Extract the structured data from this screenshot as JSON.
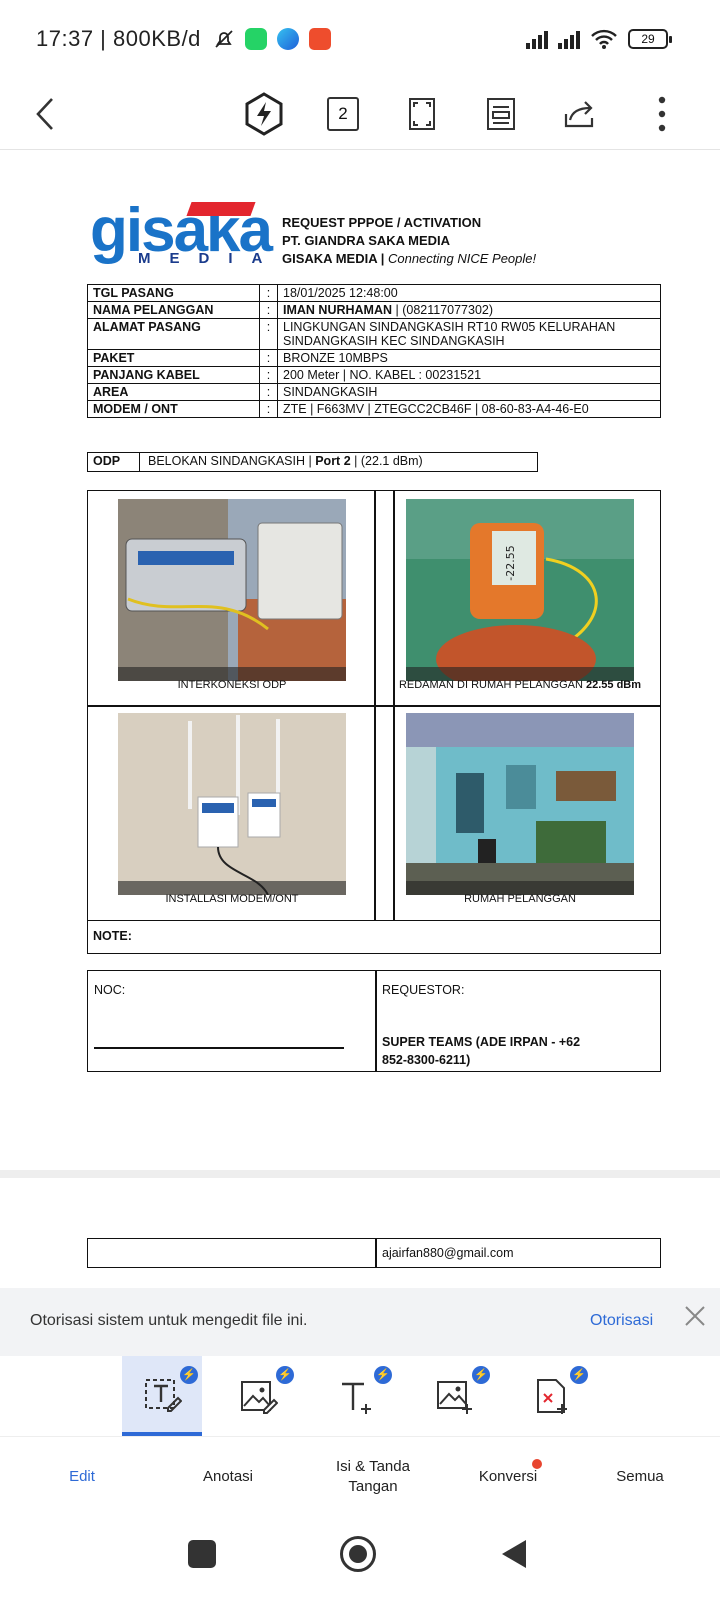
{
  "status": {
    "time": "17:37",
    "network": "800KB/d",
    "battery": "29"
  },
  "toolbar": {
    "page_count": "2",
    "icons": [
      "back-icon",
      "power-mode-icon",
      "page-count",
      "fullscreen-icon",
      "read-mode-icon",
      "share-icon",
      "more-icon"
    ]
  },
  "document": {
    "logo": {
      "brand": "gisaka",
      "sub": "MEDIA"
    },
    "header": {
      "line1": "REQUEST PPPOE / ACTIVATION",
      "line2": "PT. GIANDRA SAKA MEDIA",
      "line3_bold": "GISAKA MEDIA | ",
      "line3_italic": "Connecting NICE People!"
    },
    "fields": [
      {
        "label": "TGL PASANG",
        "sep": ":",
        "value": "18/01/2025 12:48:00"
      },
      {
        "label": "NAMA PELANGGAN",
        "sep": ":",
        "value_bold": "IMAN NURHAMAN",
        "value": " | (082117077302)"
      },
      {
        "label": "ALAMAT PASANG",
        "sep": ":",
        "value": "LINGKUNGAN SINDANGKASIH RT10 RW05 KELURAHAN SINDANGKASIH KEC SINDANGKASIH"
      },
      {
        "label": "PAKET",
        "sep": ":",
        "value": "BRONZE 10MBPS"
      },
      {
        "label": "PANJANG KABEL",
        "sep": ":",
        "value": "200  Meter  | NO. KABEL : 00231521"
      },
      {
        "label": "AREA",
        "sep": ":",
        "value": "SINDANGKASIH"
      },
      {
        "label": "MODEM / ONT",
        "sep": ":",
        "value": "ZTE |  F663MV | ZTEGCC2CB46F |  08-60-83-A4-46-E0"
      }
    ],
    "odp": {
      "label": "ODP",
      "value": "BELOKAN SINDANGKASIH",
      "sep": "|",
      "port": "Port 2",
      "power": "(22.1 dBm)"
    },
    "photos": [
      {
        "caption": "INTERKONEKSI ODP"
      },
      {
        "caption": "REDAMAN DI RUMAH PELANGGAN",
        "caption_bold": "22.55 dBm",
        "meter_reading": "-22.55"
      },
      {
        "caption": "INSTALLASI MODEM/ONT"
      },
      {
        "caption": "RUMAH PELANGGAN"
      }
    ],
    "note_label": "NOTE:",
    "noc_label": "NOC:",
    "requestor_label": "REQUESTOR:",
    "requestor_value": "SUPER TEAMS (ADE IRPAN - +62 852-8300-6211)",
    "email": "ajairfan880@gmail.com"
  },
  "auth_banner": {
    "message": "Otorisasi sistem untuk mengedit file ini.",
    "action": "Otorisasi"
  },
  "tools": [
    {
      "name": "edit-text-tool",
      "active": true
    },
    {
      "name": "edit-image-tool"
    },
    {
      "name": "add-text-tool"
    },
    {
      "name": "add-image-tool"
    },
    {
      "name": "page-tool"
    }
  ],
  "tabs": {
    "edit": "Edit",
    "annotate": "Anotasi",
    "fill_sign": "Isi & Tanda Tangan",
    "convert": "Konversi",
    "all": "Semua"
  },
  "colors": {
    "accent": "#2e6ad6",
    "brand_blue": "#1a73c8",
    "brand_red": "#e3262e"
  }
}
